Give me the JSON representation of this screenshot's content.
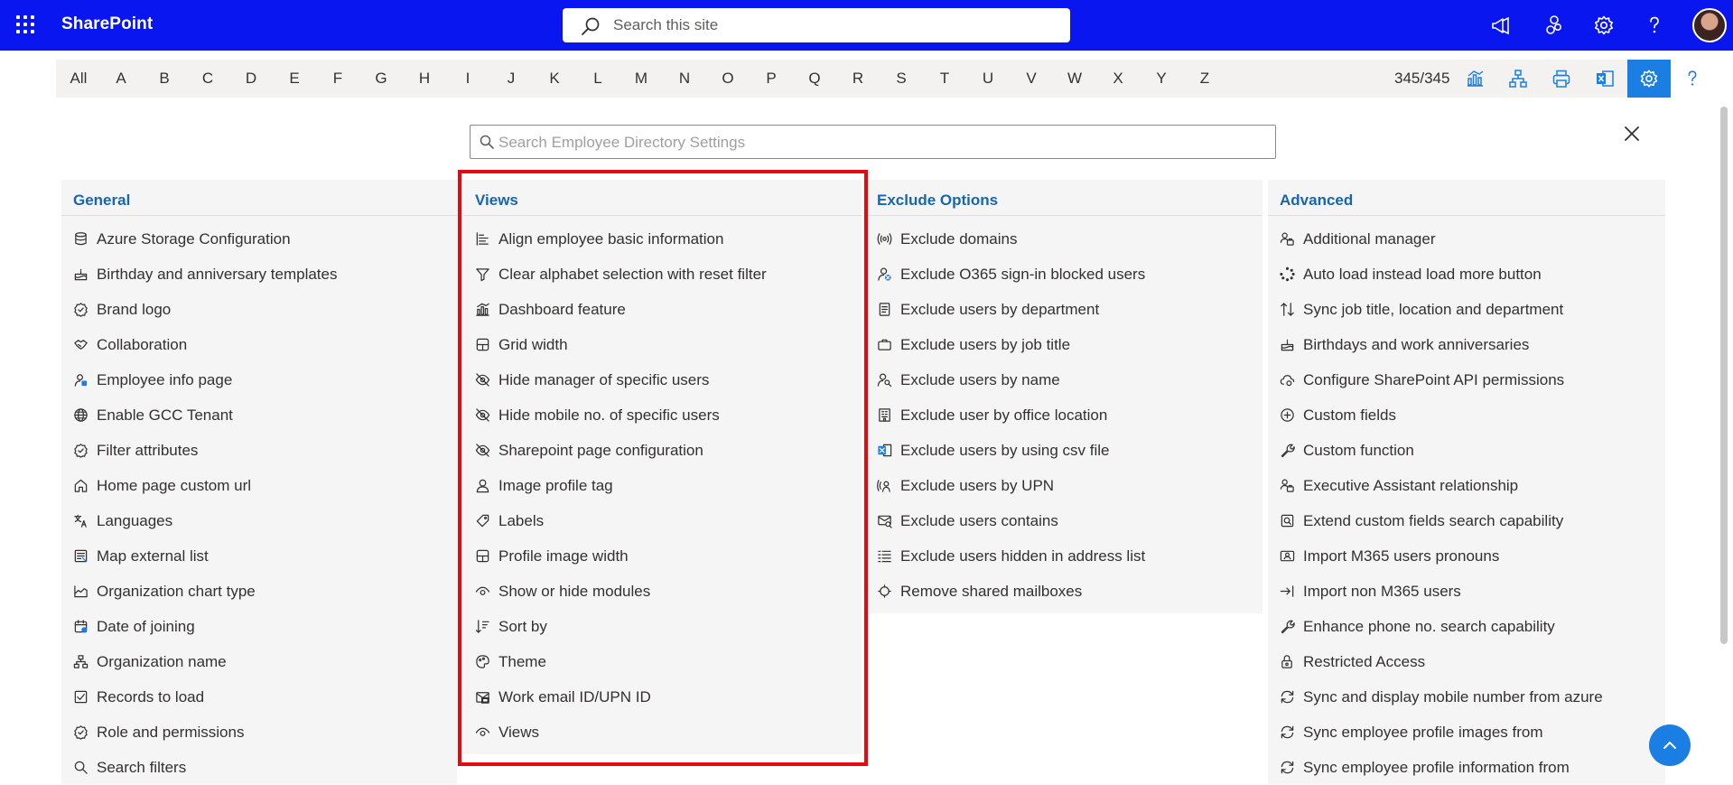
{
  "suitebar": {
    "brand": "SharePoint",
    "search_placeholder": "Search this site",
    "icons": [
      "megaphone-icon",
      "sharepoint-feed-icon",
      "gear-icon",
      "help-icon",
      "avatar"
    ],
    "accent": "#0a16ef"
  },
  "alphabet": {
    "letters": [
      "All",
      "A",
      "B",
      "C",
      "D",
      "E",
      "F",
      "G",
      "H",
      "I",
      "J",
      "K",
      "L",
      "M",
      "N",
      "O",
      "P",
      "Q",
      "R",
      "S",
      "T",
      "U",
      "V",
      "W",
      "X",
      "Y",
      "Z"
    ],
    "count": "345/345",
    "tools": [
      "chart-icon",
      "org-chart-icon",
      "print-icon",
      "excel-icon",
      "gear-icon",
      "help-icon"
    ],
    "active_tool": "gear-icon",
    "active_color": "#1b7ee3"
  },
  "settings_search": {
    "placeholder": "Search Employee Directory Settings"
  },
  "columns": [
    {
      "title": "General",
      "items": [
        {
          "icon": "database-icon",
          "label": "Azure Storage Configuration"
        },
        {
          "icon": "cake-icon",
          "label": "Birthday and anniversary templates"
        },
        {
          "icon": "badge-icon",
          "label": "Brand logo"
        },
        {
          "icon": "handshake-icon",
          "label": "Collaboration"
        },
        {
          "icon": "person-info-icon",
          "label": "Employee info page"
        },
        {
          "icon": "globe-icon",
          "label": "Enable GCC Tenant"
        },
        {
          "icon": "badge-icon",
          "label": "Filter attributes"
        },
        {
          "icon": "home-icon",
          "label": "Home page custom url"
        },
        {
          "icon": "translate-icon",
          "label": "Languages"
        },
        {
          "icon": "map-list-icon",
          "label": "Map external list"
        },
        {
          "icon": "area-chart-icon",
          "label": "Organization chart type"
        },
        {
          "icon": "calendar-icon",
          "label": "Date of joining"
        },
        {
          "icon": "org-chart-icon",
          "label": "Organization name"
        },
        {
          "icon": "records-icon",
          "label": "Records to load"
        },
        {
          "icon": "badge-icon",
          "label": "Role and permissions"
        },
        {
          "icon": "search-icon",
          "label": "Search filters"
        }
      ]
    },
    {
      "title": "Views",
      "items": [
        {
          "icon": "align-icon",
          "label": "Align employee basic information"
        },
        {
          "icon": "filter-icon",
          "label": "Clear alphabet selection with reset filter"
        },
        {
          "icon": "chart-icon",
          "label": "Dashboard feature"
        },
        {
          "icon": "grid-icon",
          "label": "Grid width"
        },
        {
          "icon": "eye-off-icon",
          "label": "Hide manager of specific users"
        },
        {
          "icon": "eye-off-icon",
          "label": "Hide mobile no. of specific users"
        },
        {
          "icon": "eye-off-icon",
          "label": "Sharepoint page configuration"
        },
        {
          "icon": "person-icon",
          "label": "Image profile tag"
        },
        {
          "icon": "tag-icon",
          "label": "Labels"
        },
        {
          "icon": "grid-icon",
          "label": "Profile image width"
        },
        {
          "icon": "eye-icon",
          "label": "Show or hide modules"
        },
        {
          "icon": "sort-icon",
          "label": "Sort by"
        },
        {
          "icon": "palette-icon",
          "label": "Theme"
        },
        {
          "icon": "mail-icon",
          "label": "Work email ID/UPN ID"
        },
        {
          "icon": "eye-icon",
          "label": "Views"
        }
      ]
    },
    {
      "title": "Exclude Options",
      "items": [
        {
          "icon": "broadcast-icon",
          "label": "Exclude domains"
        },
        {
          "icon": "person-blocked-icon",
          "label": "Exclude O365 sign-in blocked users"
        },
        {
          "icon": "document-icon",
          "label": "Exclude users by department"
        },
        {
          "icon": "briefcase-icon",
          "label": "Exclude users by job title"
        },
        {
          "icon": "person-search-icon",
          "label": "Exclude users by name"
        },
        {
          "icon": "building-icon",
          "label": "Exclude user by office location"
        },
        {
          "icon": "excel-icon",
          "label": "Exclude users by using csv file"
        },
        {
          "icon": "broadcast-person-icon",
          "label": "Exclude users by UPN"
        },
        {
          "icon": "mail-search-icon",
          "label": "Exclude users contains"
        },
        {
          "icon": "list-icon",
          "label": "Exclude users hidden in address list"
        },
        {
          "icon": "mailbox-icon",
          "label": "Remove shared mailboxes"
        }
      ]
    },
    {
      "title": "Advanced",
      "items": [
        {
          "icon": "people-icon",
          "label": "Additional manager"
        },
        {
          "icon": "loading-icon",
          "label": "Auto load instead load more button"
        },
        {
          "icon": "sync-arrows-icon",
          "label": "Sync job title, location and department"
        },
        {
          "icon": "cake-icon",
          "label": "Birthdays and work anniversaries"
        },
        {
          "icon": "cloud-settings-icon",
          "label": "Configure SharePoint API permissions"
        },
        {
          "icon": "add-circle-icon",
          "label": "Custom fields"
        },
        {
          "icon": "wrench-icon",
          "label": "Custom function"
        },
        {
          "icon": "people-icon",
          "label": "Executive Assistant relationship"
        },
        {
          "icon": "search-box-icon",
          "label": "Extend custom fields search capability"
        },
        {
          "icon": "contact-card-icon",
          "label": "Import M365 users pronouns"
        },
        {
          "icon": "import-arrow-icon",
          "label": "Import non M365 users"
        },
        {
          "icon": "wrench-icon",
          "label": "Enhance phone no. search capability"
        },
        {
          "icon": "lock-person-icon",
          "label": "Restricted Access"
        },
        {
          "icon": "sync-icon",
          "label": "Sync and display mobile number from azure"
        },
        {
          "icon": "sync-icon",
          "label": "Sync employee profile images from"
        },
        {
          "icon": "sync-icon",
          "label": "Sync employee profile information from"
        }
      ]
    }
  ],
  "colors": {
    "column_title": "#1666b0",
    "highlight_border": "#e8090f",
    "column_bg": "#f5f5f5"
  }
}
